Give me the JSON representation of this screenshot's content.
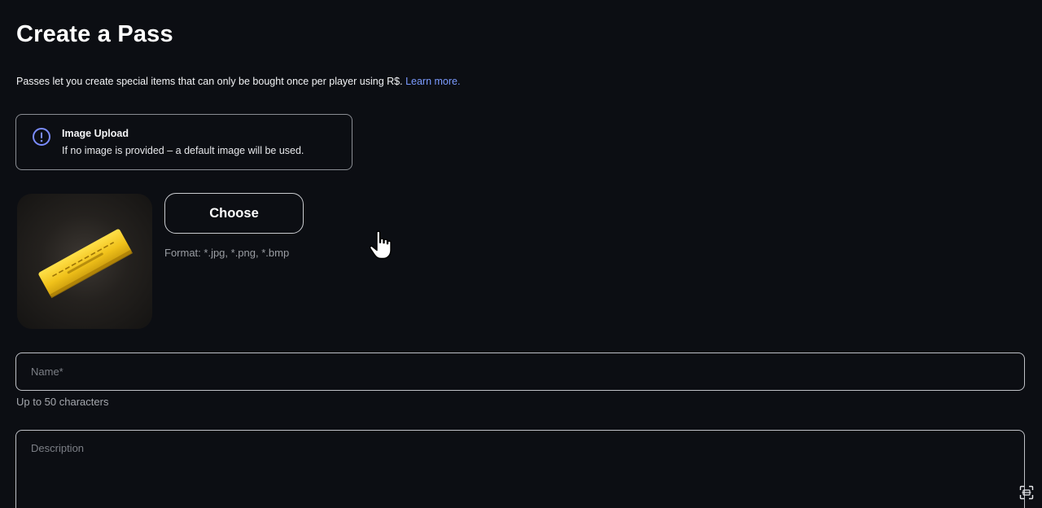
{
  "page": {
    "title": "Create a Pass",
    "intro_text": "Passes let you create special items that can only be bought once per player using R$.",
    "learn_more_label": "Learn more."
  },
  "info_box": {
    "icon": "info-circle-icon",
    "title": "Image Upload",
    "text": "If no image is provided – a default image will be used."
  },
  "upload": {
    "choose_label": "Choose",
    "format_text": "Format: *.jpg, *.png, *.bmp"
  },
  "name_field": {
    "placeholder": "Name*",
    "value": "",
    "hint": "Up to 50 characters"
  },
  "description_field": {
    "placeholder": "Description",
    "value": ""
  },
  "colors": {
    "background": "#0c0e13",
    "link": "#7b9bff",
    "info_icon": "#7b8cff",
    "ticket_gold": "#f2c81c",
    "field_border": "#bfc1c6"
  }
}
